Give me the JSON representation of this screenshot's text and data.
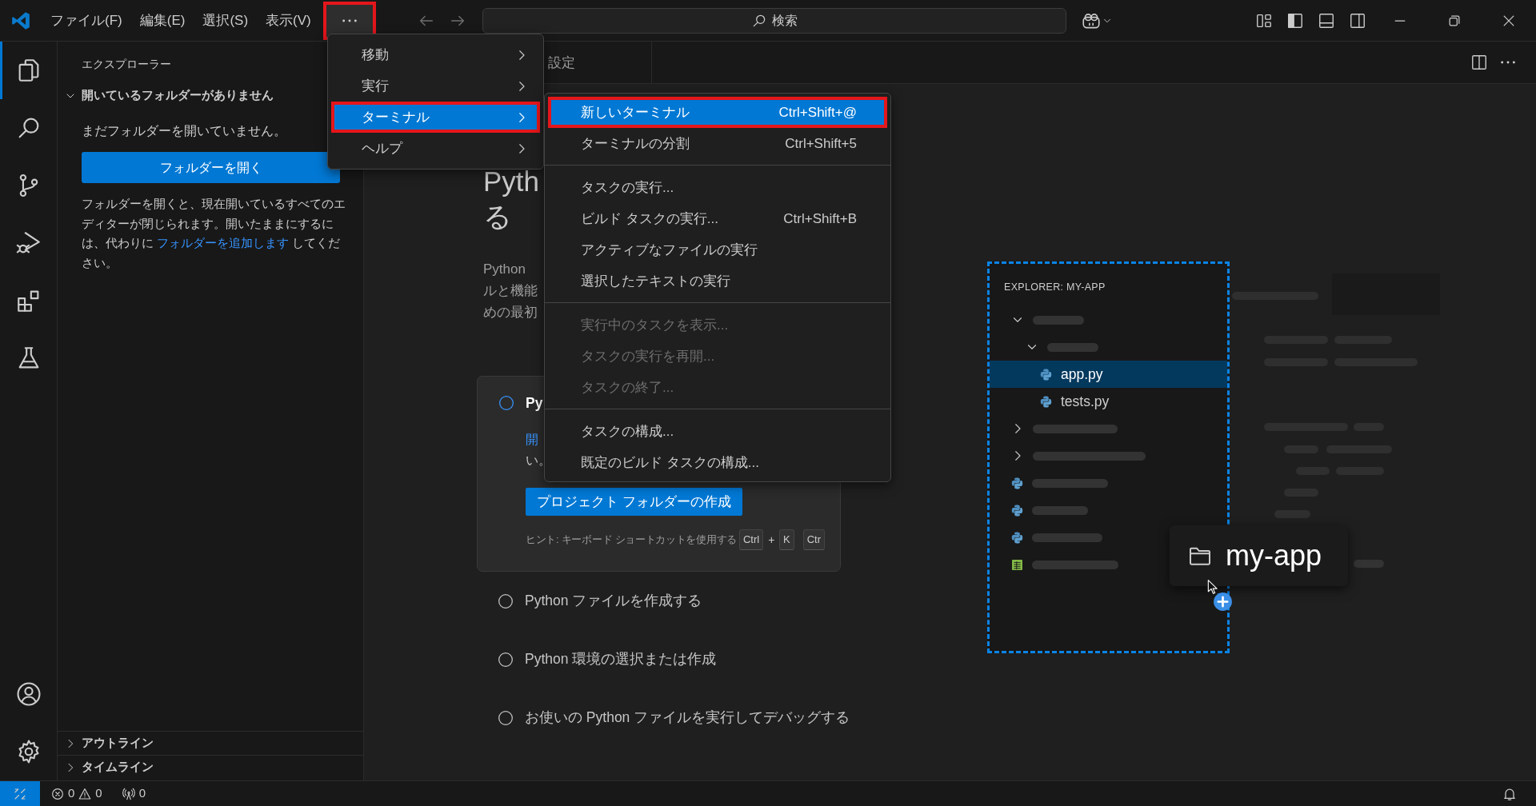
{
  "title_bar": {
    "menus": [
      "ファイル(F)",
      "編集(E)",
      "選択(S)",
      "表示(V)"
    ],
    "more_button": {
      "open": true,
      "annotated": true
    },
    "search": {
      "placeholder": "検索"
    }
  },
  "activity_bar": {
    "items": [
      {
        "kind": "explorer",
        "selected": true
      },
      {
        "kind": "search",
        "selected": false
      },
      {
        "kind": "source-control",
        "selected": false
      },
      {
        "kind": "run-debug",
        "selected": false
      },
      {
        "kind": "extensions",
        "selected": false
      },
      {
        "kind": "testing",
        "selected": false
      }
    ],
    "bottom": [
      {
        "kind": "account"
      },
      {
        "kind": "settings"
      }
    ]
  },
  "sidebar": {
    "title": "エクスプローラー",
    "section": {
      "label": "開いているフォルダーがありません",
      "expanded": true
    },
    "message": "まだフォルダーを開いていません。",
    "open_button": "フォルダーを開く",
    "note_parts": [
      {
        "text": "フォルダーを開くと、現在開いているすべてのエディターが閉じられます。開いたままにするには、代わりに ",
        "link": false
      },
      {
        "text": "フォルダーを追加します",
        "link": true
      },
      {
        "text": " してください。",
        "link": false
      }
    ],
    "panels": [
      {
        "label": "アウトライン",
        "expanded": false
      },
      {
        "label": "タイムライン",
        "expanded": false
      }
    ]
  },
  "menu": {
    "items": [
      {
        "label": "移動",
        "selected": false,
        "annotated": false
      },
      {
        "label": "実行",
        "selected": false,
        "annotated": false
      },
      {
        "label": "ターミナル",
        "selected": true,
        "annotated": true
      },
      {
        "label": "ヘルプ",
        "selected": false,
        "annotated": false
      }
    ]
  },
  "submenu": {
    "groups": [
      {
        "items": [
          {
            "label": "新しいターミナル",
            "shortcut": "Ctrl+Shift+@",
            "selected": true,
            "annotated": true,
            "disabled": false
          },
          {
            "label": "ターミナルの分割",
            "shortcut": "Ctrl+Shift+5",
            "selected": false,
            "annotated": false,
            "disabled": false
          }
        ]
      },
      {
        "items": [
          {
            "label": "タスクの実行...",
            "selected": false,
            "annotated": false,
            "disabled": false
          },
          {
            "label": "ビルド タスクの実行...",
            "shortcut": "Ctrl+Shift+B",
            "selected": false,
            "annotated": false,
            "disabled": false
          },
          {
            "label": "アクティブなファイルの実行",
            "selected": false,
            "annotated": false,
            "disabled": false
          },
          {
            "label": "選択したテキストの実行",
            "selected": false,
            "annotated": false,
            "disabled": false
          }
        ]
      },
      {
        "items": [
          {
            "label": "実行中のタスクを表示...",
            "selected": false,
            "annotated": false,
            "disabled": true
          },
          {
            "label": "タスクの実行を再開...",
            "selected": false,
            "annotated": false,
            "disabled": true
          },
          {
            "label": "タスクの終了...",
            "selected": false,
            "annotated": false,
            "disabled": true
          }
        ]
      },
      {
        "items": [
          {
            "label": "タスクの構成...",
            "selected": false,
            "annotated": false,
            "disabled": false
          },
          {
            "label": "既定のビルド タスクの構成...",
            "selected": false,
            "annotated": false,
            "disabled": false
          }
        ]
      }
    ]
  },
  "editor": {
    "tab": {
      "label": "設定"
    },
    "heading": [
      "Pyth",
      "る"
    ],
    "intro": [
      "Python",
      "ルと機能",
      "めの最初"
    ],
    "steps": [
      {
        "title": "Py",
        "selected": true,
        "checked": false,
        "detail": {
          "link": "開",
          "text": "い。",
          "button": "プロジェクト フォルダーの作成",
          "hint": "ヒント: キーボード ショートカットを使用する",
          "shortcut": [
            {
              "kind": "key",
              "text": "Ctrl"
            },
            {
              "kind": "plus",
              "text": "+"
            },
            {
              "kind": "key",
              "text": "K"
            },
            {
              "kind": "key",
              "text": "Ctr"
            }
          ]
        }
      },
      {
        "title": "Python ファイルを作成する",
        "selected": false,
        "checked": false
      },
      {
        "title": "Python 環境の選択または作成",
        "selected": false,
        "checked": false
      },
      {
        "title": "お使いの Python ファイルを実行してデバッグする",
        "selected": false,
        "checked": false
      }
    ]
  },
  "illustration": {
    "title": "EXPLORER: MY-APP",
    "tree": [
      {
        "kind": "folder",
        "expanded": true,
        "selected": false,
        "children": [
          {
            "kind": "folder",
            "expanded": true,
            "selected": false,
            "children": [
              {
                "kind": "python",
                "label": "app.py",
                "selected": true
              },
              {
                "kind": "python",
                "label": "tests.py",
                "selected": false
              }
            ]
          }
        ]
      },
      {
        "kind": "folder",
        "expanded": false,
        "selected": false
      },
      {
        "kind": "folder",
        "expanded": false,
        "selected": false
      },
      {
        "kind": "python",
        "selected": false
      },
      {
        "kind": "python",
        "selected": false
      },
      {
        "kind": "python",
        "selected": false
      },
      {
        "kind": "sheet",
        "selected": false
      }
    ],
    "drag": {
      "label": "my-app"
    }
  },
  "status_bar": {
    "errors": "0",
    "warnings": "0",
    "ports": "0"
  }
}
